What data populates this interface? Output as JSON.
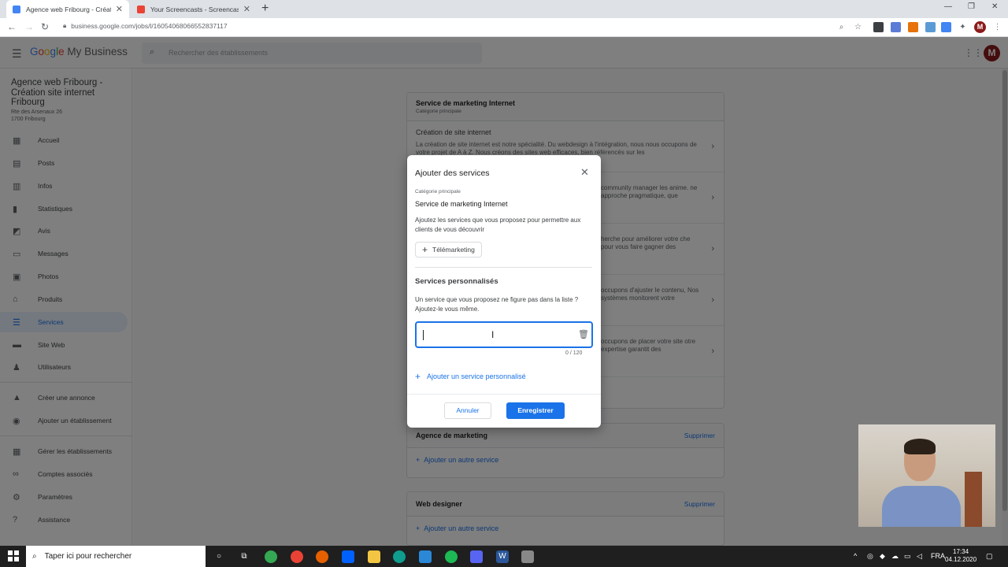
{
  "browser": {
    "tabs": [
      {
        "title": "Agence web Fribourg - Création",
        "close": "✕",
        "favicon_color": "#4285f4"
      },
      {
        "title": "Your Screencasts - Screencastify",
        "close": "✕",
        "favicon_color": "#ea4335"
      }
    ],
    "new_tab": "+",
    "url": "business.google.com/jobs/l/16054068066552837117"
  },
  "app": {
    "logo": {
      "g": "G",
      "o1": "o",
      "o2": "o",
      "g2": "g",
      "l": "l",
      "e": "e",
      "rest": " My Business"
    },
    "search_placeholder": "Rechercher des établissements",
    "user_initial": "M"
  },
  "sidebar": {
    "business_name": "Agence web Fribourg - Création site internet Fribourg",
    "address_line1": "Rte des Arsenaux 26",
    "address_line2": "1700 Fribourg",
    "items": [
      {
        "label": "Accueil",
        "icon": "▦"
      },
      {
        "label": "Posts",
        "icon": "▤"
      },
      {
        "label": "Infos",
        "icon": "▥"
      },
      {
        "label": "Statistiques",
        "icon": "▮"
      },
      {
        "label": "Avis",
        "icon": "◩"
      },
      {
        "label": "Messages",
        "icon": "▭"
      },
      {
        "label": "Photos",
        "icon": "▣"
      },
      {
        "label": "Produits",
        "icon": "⌂"
      },
      {
        "label": "Services",
        "icon": "☰"
      },
      {
        "label": "Site Web",
        "icon": "▬"
      },
      {
        "label": "Utilisateurs",
        "icon": "♟"
      }
    ],
    "items2": [
      {
        "label": "Créer une annonce",
        "icon": "▲"
      },
      {
        "label": "Ajouter un établissement",
        "icon": "◉"
      }
    ],
    "items3": [
      {
        "label": "Gérer les établissements",
        "icon": "▦"
      },
      {
        "label": "Comptes associés",
        "icon": "∞"
      },
      {
        "label": "Paramètres",
        "icon": "⚙"
      },
      {
        "label": "Assistance",
        "icon": "?"
      }
    ]
  },
  "main": {
    "card1": {
      "title": "Service de marketing Internet",
      "subtitle": "Catégorie principale",
      "services": [
        {
          "name": "Création de site internet",
          "desc": "La création de site internet est notre spécialité. Du webdesign à l'intégration, nous nous occupons de votre projet de A à Z. Nous créons des sites web efficaces, bien référencés sur les"
        },
        {
          "name": "",
          "desc": "community manager les anime. ne approche pragmatique, que"
        },
        {
          "name": "",
          "desc": "herche pour améliorer votre che pour vous faire gagner des"
        },
        {
          "name": "",
          "desc": "occupons d'ajuster le contenu, Nos systèmes monitorent votre"
        },
        {
          "name": "",
          "desc": "occupons de placer votre site otre expertise garantit des"
        }
      ]
    },
    "card2": {
      "title": "Agence de marketing",
      "delete": "Supprimer",
      "add": "Ajouter un autre service"
    },
    "card3": {
      "title": "Web designer",
      "delete": "Supprimer",
      "add": "Ajouter un autre service"
    }
  },
  "dialog": {
    "title": "Ajouter des services",
    "category_label": "Catégorie principale",
    "category": "Service de marketing Internet",
    "description": "Ajoutez les services que vous proposez pour permettre aux clients de vous découvrir",
    "chip": "Télémarketing",
    "custom_heading": "Services personnalisés",
    "custom_desc": "Un service que vous proposez ne figure pas dans la liste ? Ajoutez-le vous même.",
    "input_value": "",
    "counter": "0 / 120",
    "add_custom": "Ajouter un service personnalisé",
    "cancel": "Annuler",
    "save": "Enregistrer"
  },
  "taskbar": {
    "search_placeholder": "Taper ici pour rechercher",
    "lang": "FRA",
    "time": "17:34",
    "date": "04.12.2020"
  },
  "colors": {
    "accent": "#1a73e8",
    "overlay": "rgba(0,0,0,0.5)"
  }
}
